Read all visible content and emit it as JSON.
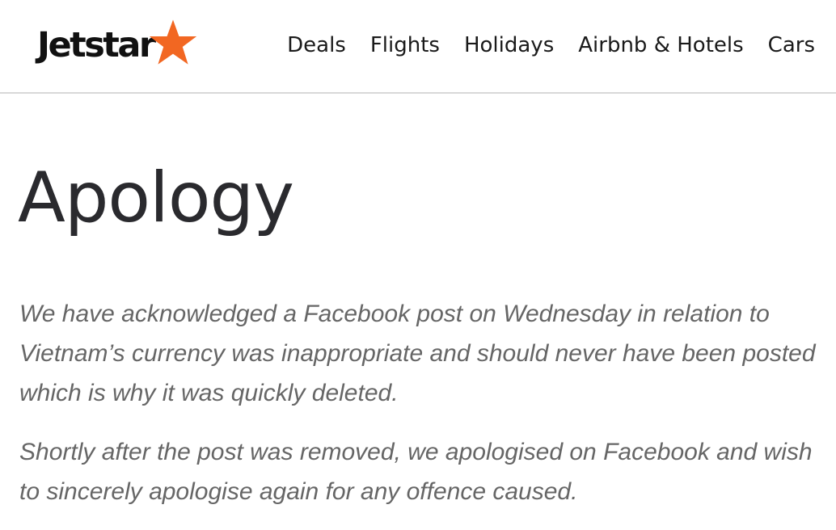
{
  "header": {
    "logo_text": "Jetstar",
    "logo_star_color": "#f26722",
    "nav": [
      {
        "label": "Deals"
      },
      {
        "label": "Flights"
      },
      {
        "label": "Holidays"
      },
      {
        "label": "Airbnb & Hotels"
      },
      {
        "label": "Cars"
      }
    ]
  },
  "main": {
    "title": "Apology",
    "paragraphs": [
      "We have acknowledged a Facebook post on Wednesday in relation to Vietnam’s currency was inappropriate and should never have been posted which is why it was quickly deleted.",
      "Shortly after the post was removed, we apologised on Facebook and wish to sincerely apologise again for any offence caused."
    ]
  }
}
